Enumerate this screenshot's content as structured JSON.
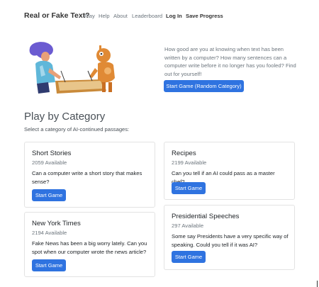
{
  "nav": {
    "brand": "Real or Fake Text?",
    "links": [
      "Play",
      "Help",
      "About",
      "Leaderboard",
      "Log In",
      "Save Progress"
    ]
  },
  "hero": {
    "text": "How good are you at knowing when text has been written by a computer? How many sentences can a computer write before it no longer has you fooled? Find out for yourself!",
    "button": "Start Game (Random Category)"
  },
  "section": {
    "title": "Play by Category",
    "subtitle": "Select a category of AI-continued passages:"
  },
  "categories": [
    {
      "title": "Short Stories",
      "count": "2059 Available",
      "description": "Can a computer write a short story that makes sense?",
      "button": "Start Game"
    },
    {
      "title": "Recipes",
      "count": "2199 Available",
      "description": "Can you tell if an AI could pass as a master chef?",
      "button": "Start Game"
    },
    {
      "title": "New York Times",
      "count": "2194 Available",
      "description": "Fake News has been a big worry lately. Can you spot when our computer wrote the news article?",
      "button": "Start Game"
    },
    {
      "title": "Presidential Speeches",
      "count": "297 Available",
      "description": "Some say Presidents have a very specific way of speaking. Could you tell if it was AI?",
      "button": "Start Game"
    }
  ],
  "colors": {
    "primary": "#2f73e0",
    "muted_text": "#6c757d",
    "card_border": "#e3e3e3"
  }
}
